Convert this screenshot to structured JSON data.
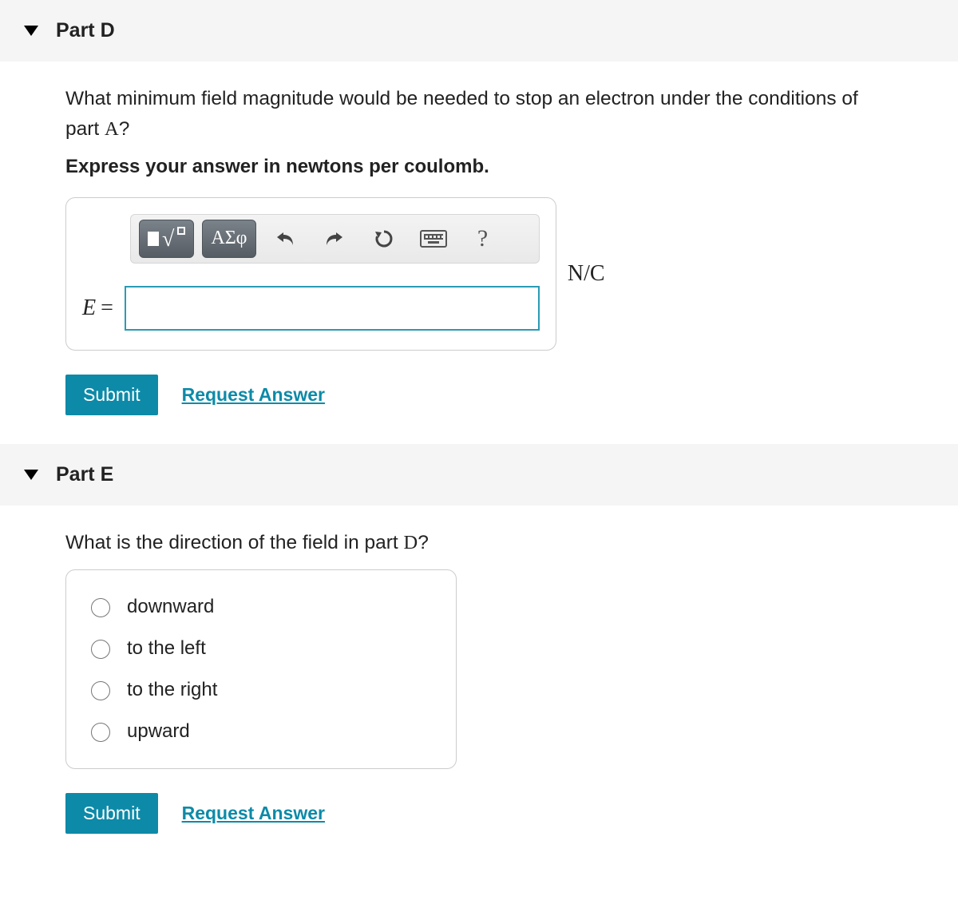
{
  "partD": {
    "title": "Part D",
    "question_prefix": "What minimum field magnitude would be needed to stop an electron under the conditions of part ",
    "question_ref": "A",
    "question_suffix": "?",
    "instructions": "Express your answer in newtons per coulomb.",
    "toolbar": {
      "templates_label": "templates",
      "greek_label": "ΑΣφ",
      "undo_label": "undo",
      "redo_label": "redo",
      "reset_label": "reset",
      "keyboard_label": "keyboard",
      "help_label": "?"
    },
    "variable": "E",
    "equals": "=",
    "input_value": "",
    "unit": "N/C",
    "submit": "Submit",
    "request": "Request Answer"
  },
  "partE": {
    "title": "Part E",
    "question_prefix": "What is the direction of the field in part ",
    "question_ref": "D",
    "question_suffix": "?",
    "options": [
      "downward",
      "to the left",
      "to the right",
      "upward"
    ],
    "submit": "Submit",
    "request": "Request Answer"
  }
}
